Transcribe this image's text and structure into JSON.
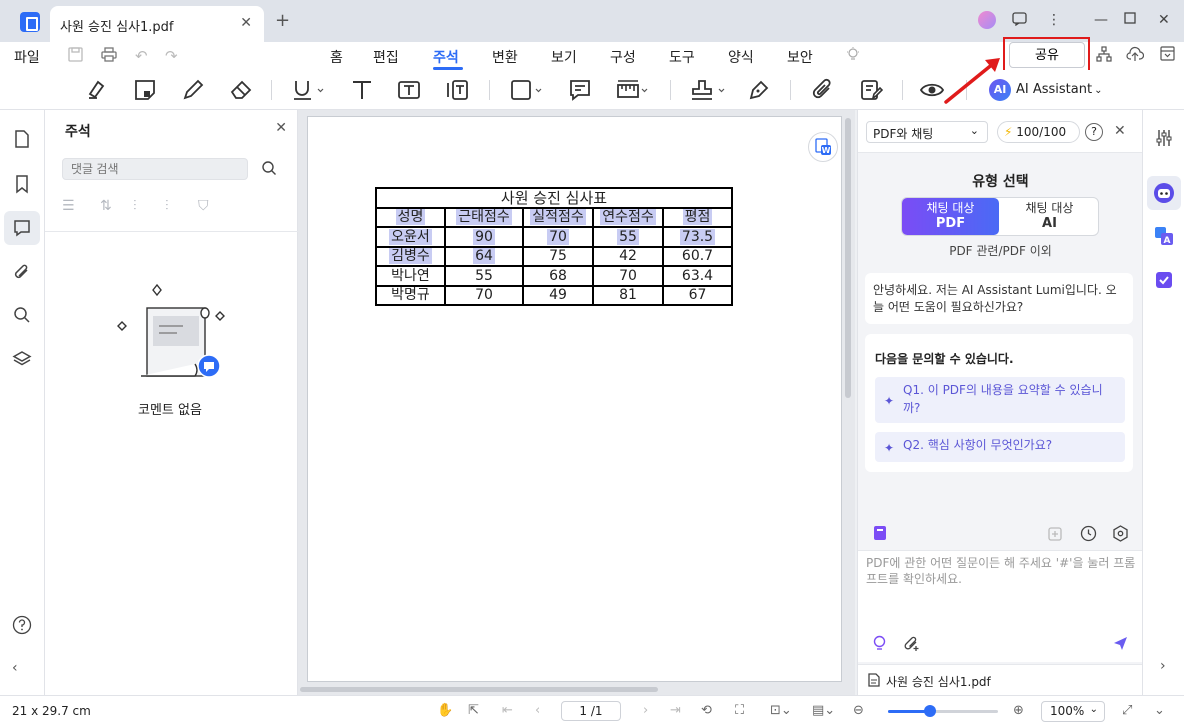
{
  "window": {
    "tab_title": "사원 승진 심사1.pdf",
    "tab_close": "✕",
    "new_tab": "+"
  },
  "menu": {
    "file": "파일",
    "items": [
      "홈",
      "편집",
      "주석",
      "변환",
      "보기",
      "구성",
      "도구",
      "양식",
      "보안"
    ],
    "active": "주석",
    "share": "공유"
  },
  "toolbar": {
    "ai_badge": "AI",
    "ai_assistant": "AI Assistant"
  },
  "comments_panel": {
    "title": "주석",
    "search_placeholder": "댓글 검색",
    "empty_text": "코멘트 없음"
  },
  "document": {
    "table_title": "사원 승진 심사표",
    "headers": [
      "성명",
      "근태점수",
      "실적점수",
      "연수점수",
      "평점"
    ],
    "rows": [
      [
        "오윤서",
        "90",
        "70",
        "55",
        "73.5"
      ],
      [
        "김병수",
        "64",
        "75",
        "42",
        "60.7"
      ],
      [
        "박나연",
        "55",
        "68",
        "70",
        "63.4"
      ],
      [
        "박명규",
        "70",
        "49",
        "81",
        "67"
      ]
    ]
  },
  "ai_panel": {
    "mode": "PDF와 채팅",
    "credits": "100/100",
    "type_title": "유형 선택",
    "option1_line1": "채팅 대상",
    "option1_line2": "PDF",
    "option2_line1": "채팅 대상",
    "option2_line2": "AI",
    "type_sub": "PDF 관련/PDF 이외",
    "greeting": "안녕하세요. 저는 AI Assistant Lumi입니다. 오늘 어떤 도움이 필요하신가요?",
    "questions_title": "다음을 문의할 수 있습니다.",
    "q1": "Q1. 이 PDF의 내용을 요약할 수 있습니까?",
    "q2": "Q2. 핵심 사항이 무엇인가요?",
    "input_placeholder": "PDF에 관한 어떤 질문이든 해 주세요 '#'을 눌러 프롬프트를 확인하세요.",
    "file_name": "사원 승진 심사1.pdf"
  },
  "status": {
    "page_size": "21 x 29.7 cm",
    "page_indicator": "1 /1",
    "zoom": "100%",
    "zoom_level_fraction": 0.38
  },
  "colors": {
    "accent": "#2d6cf6",
    "highlight": "#c8ccf3",
    "share_outline": "#e01b1b",
    "arrow": "#e01b1b"
  }
}
